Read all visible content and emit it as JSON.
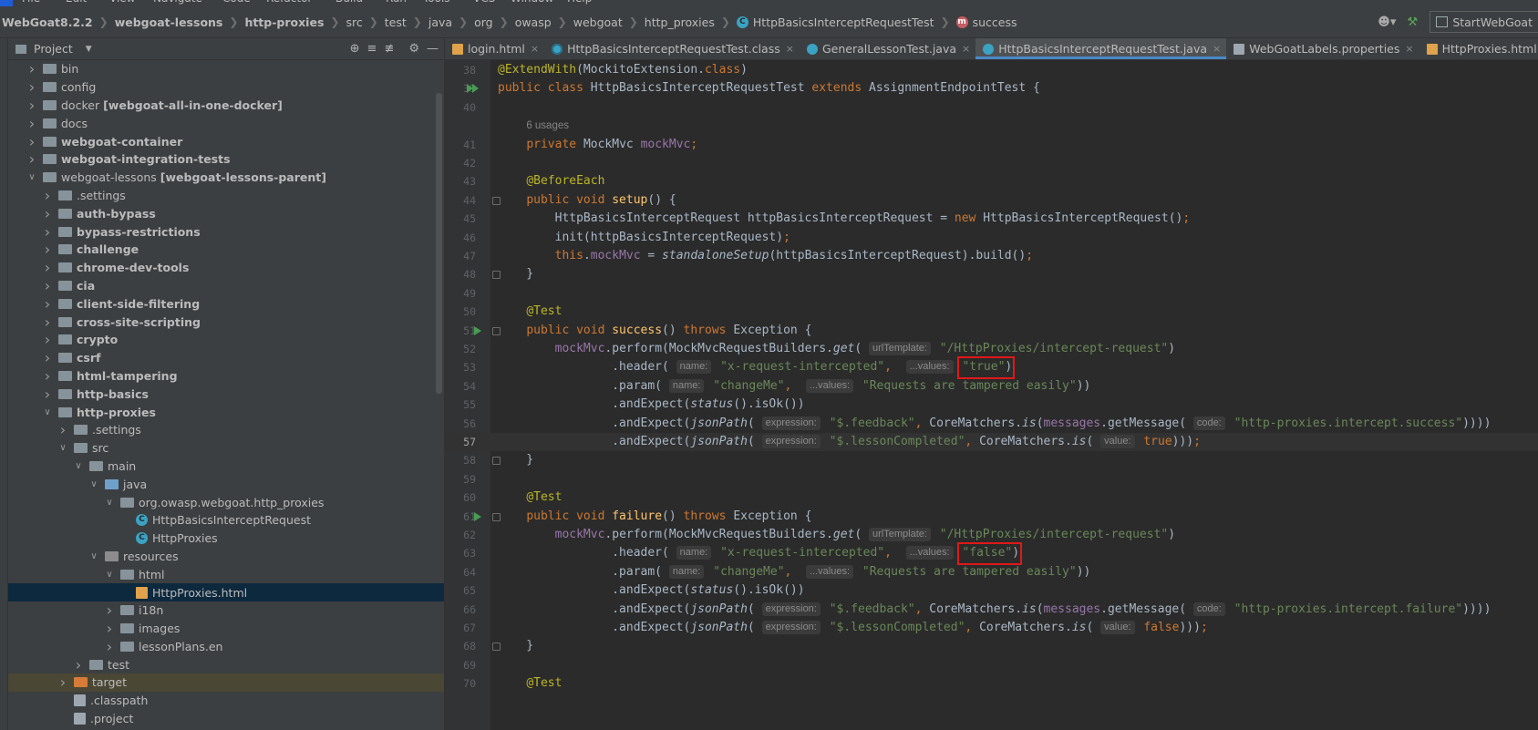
{
  "menu": [
    "File",
    "Edit",
    "View",
    "Navigate",
    "Code",
    "Refactor",
    "Build",
    "Run",
    "Tools",
    "VCS",
    "Window",
    "Help"
  ],
  "breadcrumbs": [
    {
      "label": "WebGoat8.2.2",
      "bold": true
    },
    {
      "label": "webgoat-lessons",
      "bold": true
    },
    {
      "label": "http-proxies",
      "bold": true
    },
    {
      "label": "src",
      "bold": false
    },
    {
      "label": "test",
      "bold": false
    },
    {
      "label": "java",
      "bold": false
    },
    {
      "label": "org",
      "bold": false
    },
    {
      "label": "owasp",
      "bold": false
    },
    {
      "label": "webgoat",
      "bold": false
    },
    {
      "label": "http_proxies",
      "bold": false
    },
    {
      "label": "HttpBasicsInterceptRequestTest",
      "bold": false,
      "icon": "class-icon"
    },
    {
      "label": "success",
      "bold": false,
      "icon": "method-icon"
    }
  ],
  "run_config": "StartWebGoat",
  "project_panel": {
    "title": "Project"
  },
  "tree": [
    {
      "depth": 1,
      "arrow": "right",
      "icon": "folder",
      "label": "bin"
    },
    {
      "depth": 1,
      "arrow": "right",
      "icon": "folder",
      "label": "config"
    },
    {
      "depth": 1,
      "arrow": "right",
      "icon": "folder",
      "label": "docker",
      "suffix": "[webgoat-all-in-one-docker]"
    },
    {
      "depth": 1,
      "arrow": "right",
      "icon": "folder",
      "label": "docs"
    },
    {
      "depth": 1,
      "arrow": "right",
      "icon": "module",
      "label": "webgoat-container",
      "bold": true
    },
    {
      "depth": 1,
      "arrow": "right",
      "icon": "module",
      "label": "webgoat-integration-tests",
      "bold": true
    },
    {
      "depth": 1,
      "arrow": "down",
      "icon": "module",
      "label": "webgoat-lessons",
      "suffix": "[webgoat-lessons-parent]"
    },
    {
      "depth": 2,
      "arrow": "right",
      "icon": "folder",
      "label": ".settings"
    },
    {
      "depth": 2,
      "arrow": "right",
      "icon": "module",
      "label": "auth-bypass",
      "bold": true
    },
    {
      "depth": 2,
      "arrow": "right",
      "icon": "module",
      "label": "bypass-restrictions",
      "bold": true
    },
    {
      "depth": 2,
      "arrow": "right",
      "icon": "module",
      "label": "challenge",
      "bold": true
    },
    {
      "depth": 2,
      "arrow": "right",
      "icon": "module",
      "label": "chrome-dev-tools",
      "bold": true
    },
    {
      "depth": 2,
      "arrow": "right",
      "icon": "module",
      "label": "cia",
      "bold": true
    },
    {
      "depth": 2,
      "arrow": "right",
      "icon": "module",
      "label": "client-side-filtering",
      "bold": true
    },
    {
      "depth": 2,
      "arrow": "right",
      "icon": "module",
      "label": "cross-site-scripting",
      "bold": true
    },
    {
      "depth": 2,
      "arrow": "right",
      "icon": "module",
      "label": "crypto",
      "bold": true
    },
    {
      "depth": 2,
      "arrow": "right",
      "icon": "module",
      "label": "csrf",
      "bold": true
    },
    {
      "depth": 2,
      "arrow": "right",
      "icon": "module",
      "label": "html-tampering",
      "bold": true
    },
    {
      "depth": 2,
      "arrow": "right",
      "icon": "module",
      "label": "http-basics",
      "bold": true
    },
    {
      "depth": 2,
      "arrow": "down",
      "icon": "module",
      "label": "http-proxies",
      "bold": true
    },
    {
      "depth": 3,
      "arrow": "right",
      "icon": "folder",
      "label": ".settings"
    },
    {
      "depth": 3,
      "arrow": "down",
      "icon": "folder",
      "label": "src"
    },
    {
      "depth": 4,
      "arrow": "down",
      "icon": "folder",
      "label": "main"
    },
    {
      "depth": 5,
      "arrow": "down",
      "icon": "src",
      "label": "java"
    },
    {
      "depth": 6,
      "arrow": "down",
      "icon": "package",
      "label": "org.owasp.webgoat.http_proxies"
    },
    {
      "depth": 7,
      "arrow": "none",
      "icon": "class",
      "label": "HttpBasicsInterceptRequest"
    },
    {
      "depth": 7,
      "arrow": "none",
      "icon": "class",
      "label": "HttpProxies"
    },
    {
      "depth": 5,
      "arrow": "down",
      "icon": "resources",
      "label": "resources"
    },
    {
      "depth": 6,
      "arrow": "down",
      "icon": "folder",
      "label": "html"
    },
    {
      "depth": 7,
      "arrow": "none",
      "icon": "html",
      "label": "HttpProxies.html",
      "selected": true
    },
    {
      "depth": 6,
      "arrow": "right",
      "icon": "folder",
      "label": "i18n"
    },
    {
      "depth": 6,
      "arrow": "right",
      "icon": "folder",
      "label": "images"
    },
    {
      "depth": 6,
      "arrow": "right",
      "icon": "folder",
      "label": "lessonPlans.en"
    },
    {
      "depth": 4,
      "arrow": "right",
      "icon": "folder",
      "label": "test"
    },
    {
      "depth": 3,
      "arrow": "right",
      "icon": "excluded",
      "label": "target",
      "excluded": true
    },
    {
      "depth": 3,
      "arrow": "none",
      "icon": "file",
      "label": ".classpath"
    },
    {
      "depth": 3,
      "arrow": "none",
      "icon": "file",
      "label": ".project"
    }
  ],
  "tabs": [
    {
      "label": "login.html",
      "icon": "html",
      "active": false
    },
    {
      "label": "HttpBasicsInterceptRequestTest.class",
      "icon": "classfile",
      "active": false
    },
    {
      "label": "GeneralLessonTest.java",
      "icon": "class",
      "active": false
    },
    {
      "label": "HttpBasicsInterceptRequestTest.java",
      "icon": "class",
      "active": true
    },
    {
      "label": "WebGoatLabels.properties",
      "icon": "properties",
      "active": false
    },
    {
      "label": "HttpProxies.html",
      "icon": "html",
      "active": false
    }
  ],
  "code": {
    "first_line": 38,
    "current_line": 57,
    "lines": {
      "l38": "@ExtendWith(MockitoExtension.class)",
      "l39": "public class HttpBasicsInterceptRequestTest extends AssignmentEndpointTest {",
      "l40": "",
      "usages": "6 usages",
      "l41": "private MockMvc mockMvc;",
      "l42": "",
      "l43": "@BeforeEach",
      "l44": "public void setup() {",
      "l45": "HttpBasicsInterceptRequest httpBasicsInterceptRequest = new HttpBasicsInterceptRequest();",
      "l46": "init(httpBasicsInterceptRequest);",
      "l47": "this.mockMvc = standaloneSetup(httpBasicsInterceptRequest).build();",
      "l48": "}",
      "l49": "",
      "l50": "@Test",
      "l51": "public void success() throws Exception {",
      "l52": "mockMvc.perform(MockMvcRequestBuilders.get( urlTemplate: \"/HttpProxies/intercept-request\")",
      "l53": ".header( name: \"x-request-intercepted\",  ...values: \"true\")",
      "l54": ".param( name: \"changeMe\",  ...values: \"Requests are tampered easily\"))",
      "l55": ".andExpect(status().isOk())",
      "l56": ".andExpect(jsonPath( expression: \"$.feedback\", CoreMatchers.is(messages.getMessage( code: \"http-proxies.intercept.success\"))))",
      "l57": ".andExpect(jsonPath( expression: \"$.lessonCompleted\", CoreMatchers.is( value: true)));",
      "l58": "}",
      "l59": "",
      "l60": "@Test",
      "l61": "public void failure() throws Exception {",
      "l62": "mockMvc.perform(MockMvcRequestBuilders.get( urlTemplate: \"/HttpProxies/intercept-request\")",
      "l63": ".header( name: \"x-request-intercepted\",  ...values: \"false\")",
      "l64": ".param( name: \"changeMe\",  ...values: \"Requests are tampered easily\"))",
      "l65": ".andExpect(status().isOk())",
      "l66": ".andExpect(jsonPath( expression: \"$.feedback\", CoreMatchers.is(messages.getMessage( code: \"http-proxies.intercept.failure\"))))",
      "l67": ".andExpect(jsonPath( expression: \"$.lessonCompleted\", CoreMatchers.is( value: false)));",
      "l68": "}",
      "l69": "",
      "l70": "@Test"
    }
  },
  "colors": {
    "highlight_box": "#e01818",
    "accent": "#4a88c7",
    "keyword": "#cc7832",
    "string": "#6a8759",
    "annotation": "#bbb529",
    "field": "#9876aa",
    "method_decl": "#ffc66d",
    "run_gutter": "#499c54"
  }
}
